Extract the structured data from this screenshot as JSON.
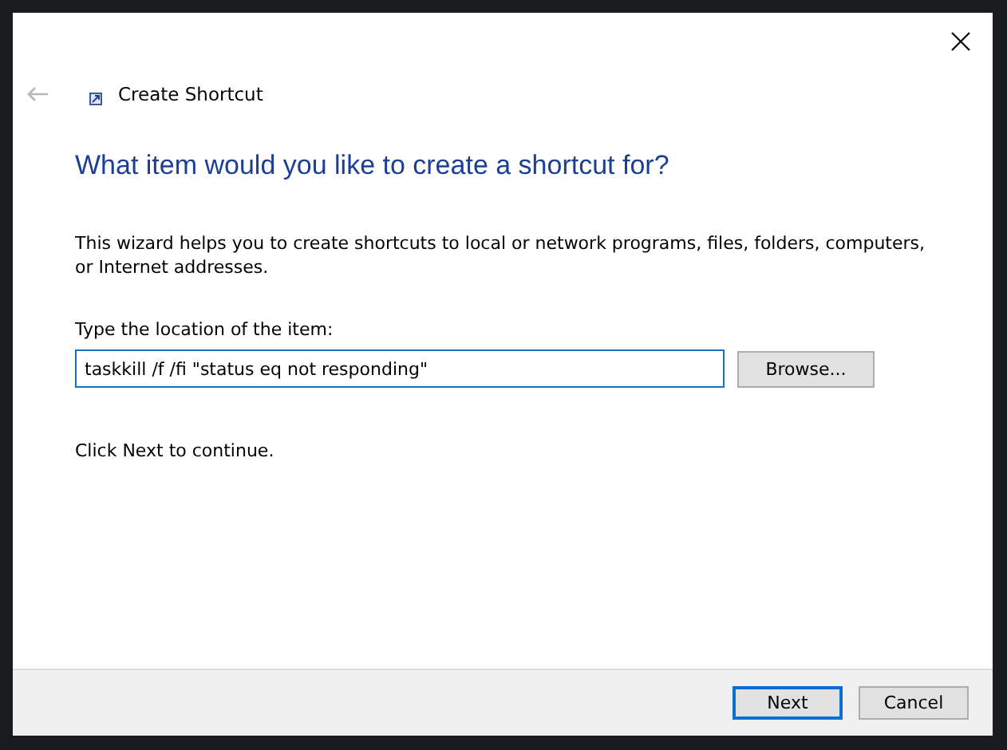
{
  "window": {
    "title": "Create Shortcut",
    "back_disabled": true
  },
  "heading": "What item would you like to create a shortcut for?",
  "description": "This wizard helps you to create shortcuts to local or network programs, files, folders, computers, or Internet addresses.",
  "location": {
    "label": "Type the location of the item:",
    "value": "taskkill /f /fi \"status eq not responding\"",
    "browse": "Browse..."
  },
  "hint": "Click Next to continue.",
  "buttons": [
    {
      "label": "Next",
      "default": true
    },
    {
      "label": "Cancel",
      "default": false
    }
  ]
}
